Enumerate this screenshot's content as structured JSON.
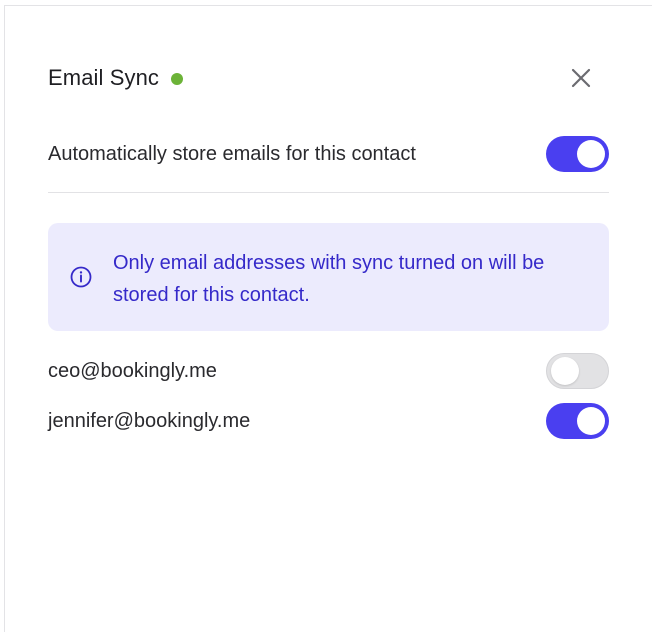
{
  "panel": {
    "title": "Email Sync",
    "status_color": "#6cb338",
    "close_icon": "close-icon"
  },
  "auto_store": {
    "label": "Automatically store emails for this contact",
    "enabled": true
  },
  "info": {
    "icon": "info-icon",
    "text": "Only email addresses with sync turned on will be stored for this contact.",
    "bg_color": "#ecebfd",
    "text_color": "#3529c9"
  },
  "emails": [
    {
      "address": "ceo@bookingly.me",
      "sync_enabled": false
    },
    {
      "address": "jennifer@bookingly.me",
      "sync_enabled": true
    }
  ],
  "colors": {
    "toggle_on": "#4a3ff0",
    "toggle_off": "#e2e2e4"
  }
}
